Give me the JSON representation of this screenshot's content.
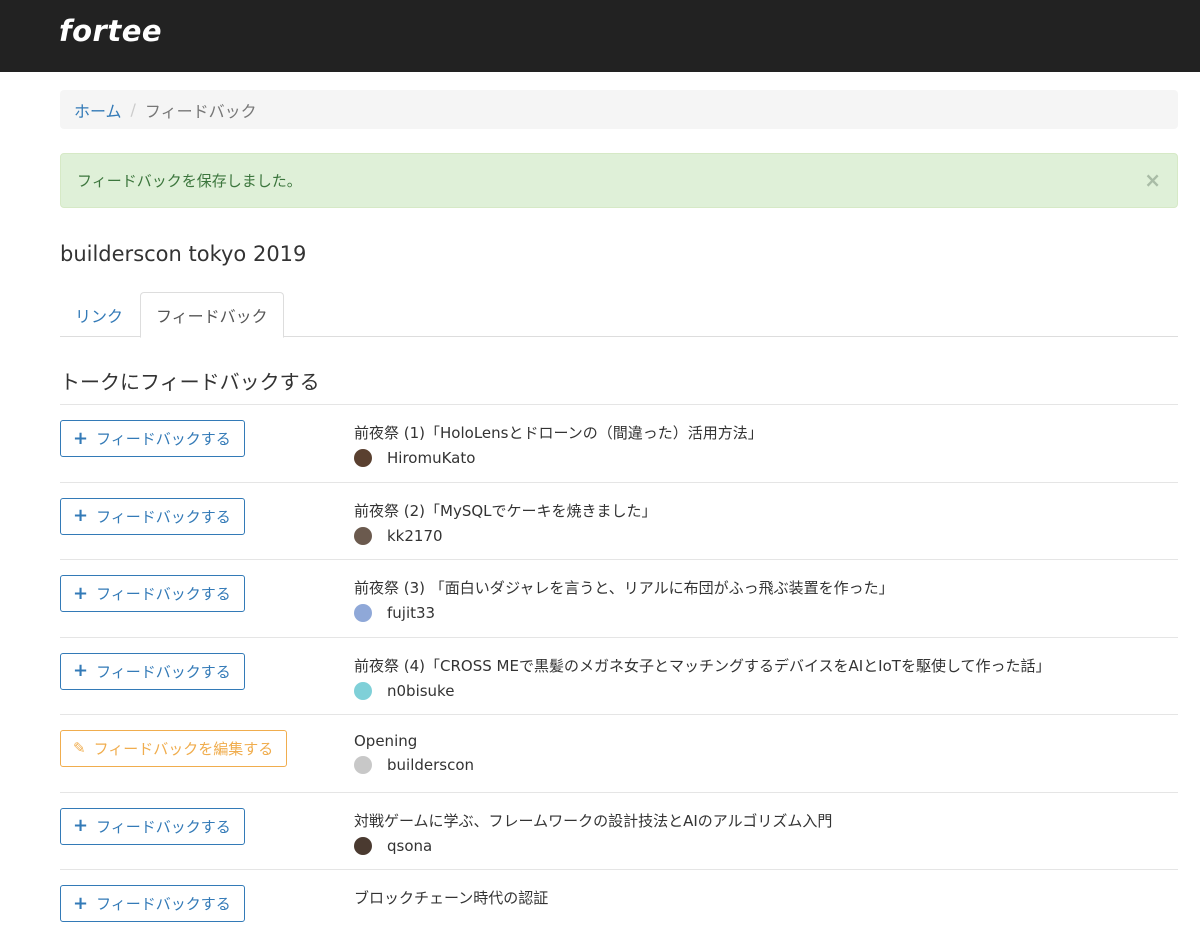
{
  "brand": {
    "name": "fortee"
  },
  "breadcrumb": {
    "home": "ホーム",
    "separator": "/",
    "current": "フィードバック"
  },
  "alert": {
    "message": "フィードバックを保存しました。",
    "close": "×"
  },
  "event": {
    "title": "builderscon tokyo 2019"
  },
  "tabs": [
    {
      "label": "リンク",
      "active": false
    },
    {
      "label": "フィードバック",
      "active": true
    }
  ],
  "section": {
    "title": "トークにフィードバックする"
  },
  "talks": [
    {
      "button": "フィードバックする",
      "button_icon": "+",
      "edit": false,
      "title": "前夜祭 (1)「HoloLensとドローンの（間違った）活用方法」",
      "speaker": "HiromuKato",
      "avatar_color": "#5a4030"
    },
    {
      "button": "フィードバックする",
      "button_icon": "+",
      "edit": false,
      "title": "前夜祭 (2)「MySQLでケーキを焼きました」",
      "speaker": "kk2170",
      "avatar_color": "#6b5a4e"
    },
    {
      "button": "フィードバックする",
      "button_icon": "+",
      "edit": false,
      "title": "前夜祭 (3) 「面白いダジャレを言うと、リアルに布団がふっ飛ぶ装置を作った」",
      "speaker": "fujit33",
      "avatar_color": "#8fa8d8"
    },
    {
      "button": "フィードバックする",
      "button_icon": "+",
      "edit": false,
      "title": "前夜祭 (4)「CROSS MEで黒髪のメガネ女子とマッチングするデバイスをAIとIoTを駆使して作った話」",
      "speaker": "n0bisuke",
      "avatar_color": "#7fd0d8"
    },
    {
      "button": "フィードバックを編集する",
      "button_icon": "✎",
      "edit": true,
      "title": "Opening",
      "speaker": "builderscon",
      "avatar_color": "#c8c8c8"
    },
    {
      "button": "フィードバックする",
      "button_icon": "+",
      "edit": false,
      "title": "対戦ゲームに学ぶ、フレームワークの設計技法とAIのアルゴリズム入門",
      "speaker": "qsona",
      "avatar_color": "#4a3a30"
    },
    {
      "button": "フィードバックする",
      "button_icon": "+",
      "edit": false,
      "title": "ブロックチェーン時代の認証",
      "speaker": "",
      "avatar_color": "#cccccc"
    }
  ],
  "colors": {
    "primary": "#337ab7",
    "warning": "#f0ad4e",
    "success_bg": "#dff0d8",
    "navbar": "#222222"
  }
}
